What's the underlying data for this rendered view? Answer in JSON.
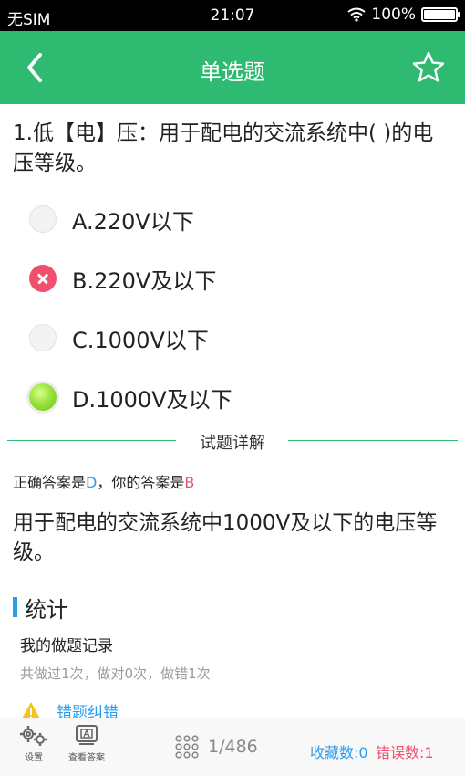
{
  "status_bar": {
    "carrier": "无SIM",
    "time": "21:07",
    "battery_percent": "100%",
    "battery_level": 1.0
  },
  "header": {
    "title": "单选题",
    "back_icon": "chevron-left-icon",
    "favorite_icon": "star-outline-icon"
  },
  "question": {
    "text": "1.低【电】压：用于配电的交流系统中( )的电压等级。",
    "options": [
      {
        "label": "A.220V以下",
        "state": "unselected"
      },
      {
        "label": "B.220V及以下",
        "state": "wrong"
      },
      {
        "label": "C.1000V以下",
        "state": "unselected"
      },
      {
        "label": "D.1000V及以下",
        "state": "correct"
      }
    ]
  },
  "explanation": {
    "section_title": "试题详解",
    "answer_prefix": "正确答案是",
    "correct_answer": "D",
    "answer_middle": "，你的答案是",
    "user_answer": "B",
    "text": "用于配电的交流系统中1000V及以下的电压等级。"
  },
  "stats": {
    "title": "统计",
    "subtitle": "我的做题记录",
    "record": "共做过1次，做对0次，做错1次",
    "report_link": "错题纠错"
  },
  "bottom_bar": {
    "settings_label": "设置",
    "view_answer_label": "查看答案",
    "progress": "1/486",
    "favorites": "收藏数:0",
    "errors": "错误数:1"
  },
  "colors": {
    "brand_green": "#2fba72",
    "accent_blue": "#2b9df0",
    "error_red": "#f0506e"
  }
}
